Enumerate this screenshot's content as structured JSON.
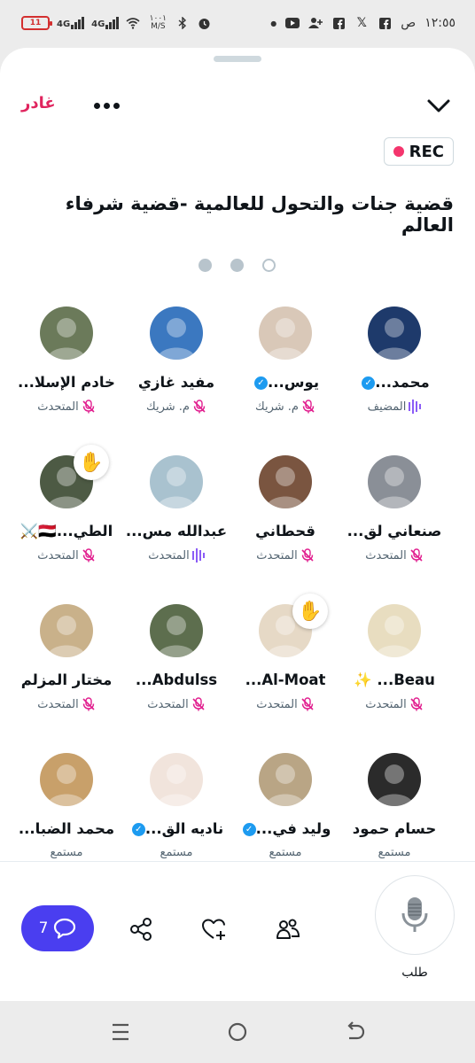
{
  "status_bar": {
    "time": "١٢:٥٥",
    "ampm": "ص",
    "battery": "11",
    "net_speed": "١٠٠١ M/S",
    "signal_1": "4G",
    "signal_2": "4G"
  },
  "header": {
    "leave_label": "غادر",
    "rec_label": "REC",
    "title": "قضية جنات والتحول للعالمية -قضية شرفاء العالم"
  },
  "pagination": {
    "pages": 3,
    "current": 3
  },
  "participants": [
    {
      "name": "محمد...",
      "verified": true,
      "role": "المضيف",
      "state": "speaking",
      "avatar_bg": "#1e3a6b"
    },
    {
      "name": "يوس...",
      "verified": true,
      "role": "م. شريك",
      "state": "muted",
      "avatar_bg": "#d9c8b8"
    },
    {
      "name": "مفيد غازي",
      "verified": false,
      "role": "م. شريك",
      "state": "muted",
      "avatar_bg": "#3b78c0"
    },
    {
      "name": "خادم الإسلا...",
      "verified": false,
      "role": "المتحدث",
      "state": "muted",
      "avatar_bg": "#6b7a5a"
    },
    {
      "name": "صنعاني لق...",
      "verified": false,
      "role": "المتحدث",
      "state": "muted",
      "avatar_bg": "#8a8f97"
    },
    {
      "name": "قحطاني",
      "verified": false,
      "role": "المتحدث",
      "state": "muted",
      "avatar_bg": "#7a5540"
    },
    {
      "name": "عبدالله مس...",
      "verified": false,
      "role": "المتحدث",
      "state": "speaking",
      "avatar_bg": "#a9c2cf"
    },
    {
      "name": "الطي...🇾🇪⚔️",
      "verified": false,
      "role": "المتحدث",
      "state": "muted",
      "avatar_bg": "#4d5a44",
      "hand": true
    },
    {
      "name": "Beau... ✨",
      "verified": false,
      "role": "المتحدث",
      "state": "muted",
      "avatar_bg": "#e8ddc0"
    },
    {
      "name": "Al-Moat...",
      "verified": false,
      "role": "المتحدث",
      "state": "muted",
      "avatar_bg": "#e6d9c6",
      "hand": true
    },
    {
      "name": "Abdulss...",
      "verified": false,
      "role": "المتحدث",
      "state": "muted",
      "avatar_bg": "#5d6e4e"
    },
    {
      "name": "مختار المزلم",
      "verified": false,
      "role": "المتحدث",
      "state": "muted",
      "avatar_bg": "#c9b18a"
    },
    {
      "name": "حسام حمود",
      "verified": false,
      "role": "مستمع",
      "state": "listener",
      "avatar_bg": "#2b2b2b"
    },
    {
      "name": "وليد في...",
      "verified": true,
      "role": "مستمع",
      "state": "listener",
      "avatar_bg": "#b9a585"
    },
    {
      "name": "ناديه الق...",
      "verified": true,
      "role": "مستمع",
      "state": "listener",
      "avatar_bg": "#f1e4dc"
    },
    {
      "name": "محمد الضبا...",
      "verified": false,
      "role": "مستمع",
      "state": "listener",
      "avatar_bg": "#c8a06a"
    }
  ],
  "bottom": {
    "chat_count": "7",
    "request_label": "طلب"
  },
  "colors": {
    "accent": "#4a3ef0",
    "rec_dot": "#f4356d",
    "leave": "#e0245e",
    "muted_icon": "#e11d8e",
    "speaking": "#8b5cf6",
    "verified": "#1d9bf0"
  }
}
